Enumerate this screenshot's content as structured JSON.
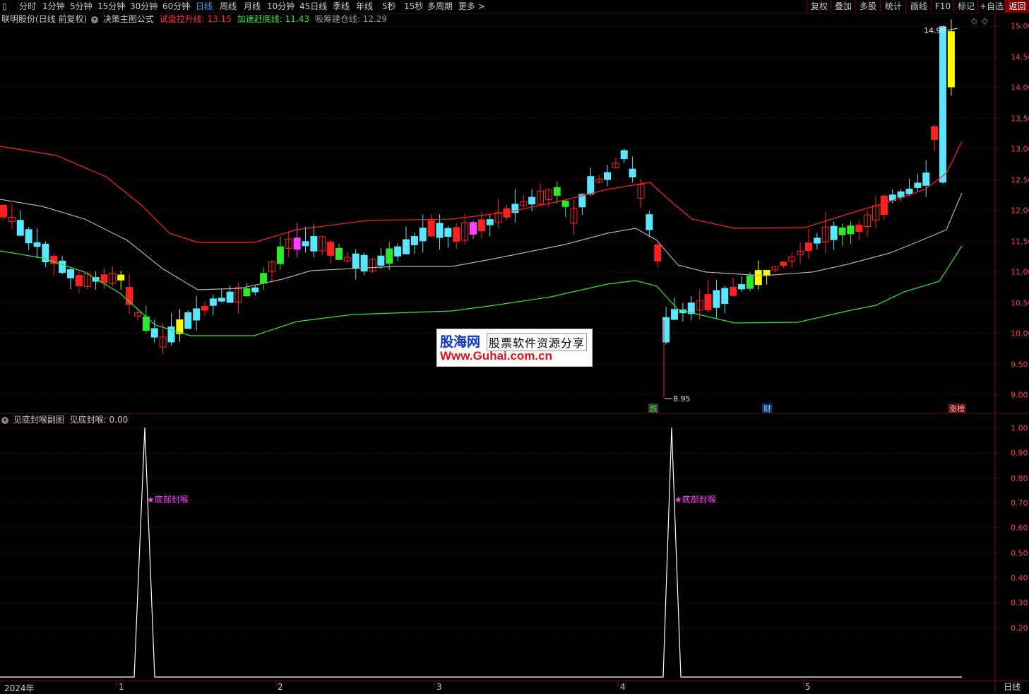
{
  "toolbar": {
    "periods": [
      "分时",
      "1分钟",
      "5分钟",
      "15分钟",
      "30分钟",
      "60分钟",
      "日线",
      "周线",
      "月线",
      "10分钟",
      "45日线",
      "季线",
      "年线",
      "5秒",
      "15秒",
      "多周期",
      "更多 >"
    ],
    "active_period": "日线",
    "right_buttons": [
      "复权",
      "叠加",
      "多股",
      "统计",
      "画线",
      "F10",
      "标记",
      "+自选",
      "返回"
    ]
  },
  "main_info": {
    "title": "联明股份(日线 前复权)",
    "formula": "决策主图公式",
    "l1_label": "试盘拉升线:",
    "l1_value": "13.15",
    "l2_label": "加速赶底线:",
    "l2_value": "11.43",
    "l3_label": "吸筹建仓线:",
    "l3_value": "12.29"
  },
  "sub_info": {
    "title": "见底封喉副图",
    "label": "见底封喉:",
    "value": "0.00"
  },
  "price_axis": [
    "15.00",
    "14.50",
    "14.00",
    "13.50",
    "13.00",
    "12.50",
    "12.00",
    "11.50",
    "11.00",
    "10.50",
    "10.00",
    "9.50",
    "9.00"
  ],
  "sub_axis": [
    "1.00",
    "0.90",
    "0.80",
    "0.70",
    "0.60",
    "0.50",
    "0.40",
    "0.30",
    "0.20"
  ],
  "annotations": {
    "high": "14.98",
    "low": "8.95",
    "signal_text": "★底部封喉",
    "marker_die": "跌",
    "marker_cai": "财",
    "marker_zhangting": "涨榜"
  },
  "time_axis": [
    "2024年",
    "1",
    "2",
    "3",
    "4",
    "5"
  ],
  "bottom_right": "日线",
  "watermark": {
    "brand": "股海网",
    "tagline": "股票软件资源分享",
    "url": "Www.Guhai.com.cn"
  },
  "colors": {
    "up": "#ff2020",
    "down": "#5ae6ff",
    "green": "#2ee82e",
    "yellow": "#ffff00",
    "magenta": "#ff40ff",
    "grid": "#7a0000",
    "active": "#3fa3ff"
  }
}
